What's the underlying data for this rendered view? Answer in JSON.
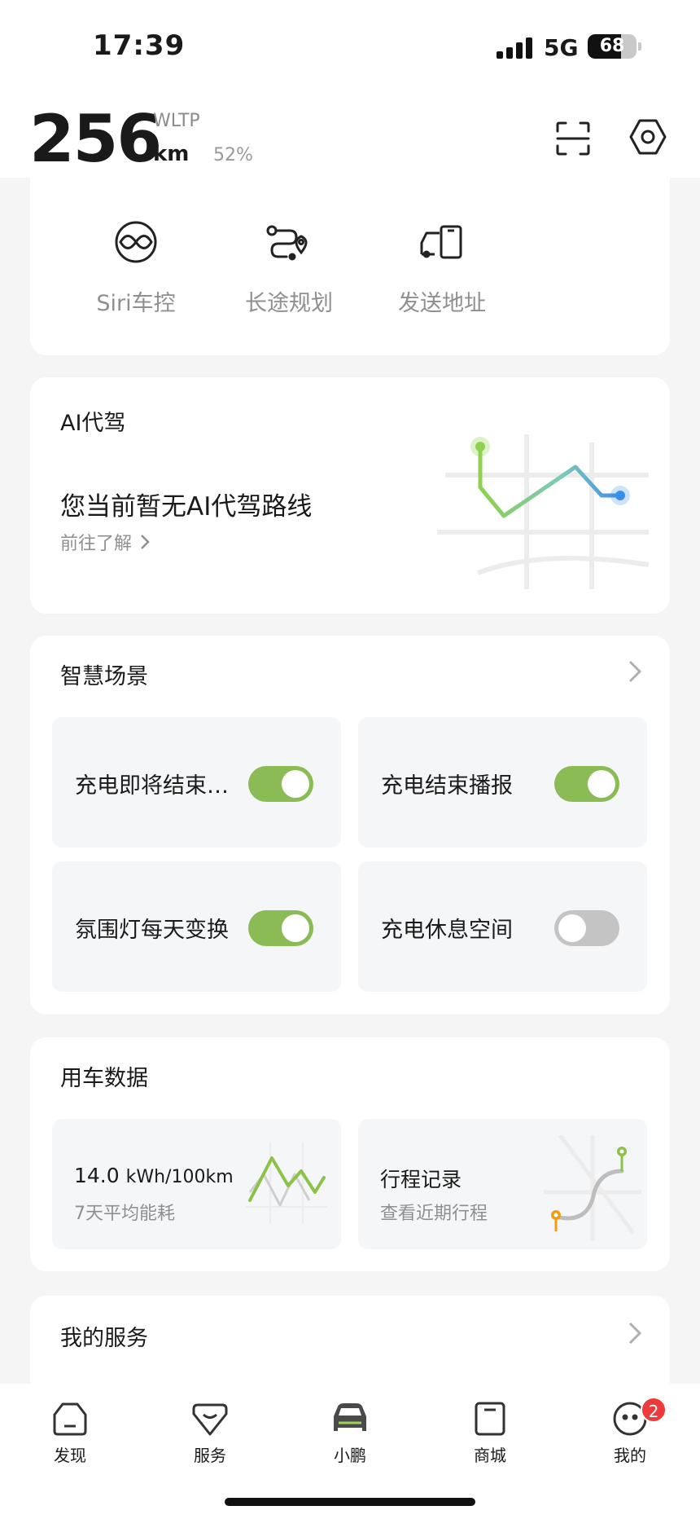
{
  "status_bar": {
    "time": "17:39",
    "network": "5G",
    "battery_level": "68",
    "battery_fraction": 0.68,
    "signal_bars": 4
  },
  "header": {
    "range_value": "256",
    "range_unit": "km",
    "range_standard": "WLTP",
    "battery_percent": "52%",
    "icons": [
      "scan-icon",
      "settings-icon"
    ]
  },
  "quick_actions": [
    {
      "label": "Siri车控",
      "icon": "siri-control-icon"
    },
    {
      "label": "长途规划",
      "icon": "route-planning-icon"
    },
    {
      "label": "发送地址",
      "icon": "send-address-icon"
    }
  ],
  "ai_drive": {
    "title": "AI代驾",
    "headline": "您当前暂无AI代驾路线",
    "link_label": "前往了解"
  },
  "scenes": {
    "title": "智慧场景",
    "items": [
      {
        "label": "充电即将结束提醒",
        "on": true
      },
      {
        "label": "充电结束播报",
        "on": true
      },
      {
        "label": "氛围灯每天变换",
        "on": true
      },
      {
        "label": "充电休息空间",
        "on": false
      }
    ]
  },
  "vehicle_data": {
    "title": "用车数据",
    "energy_value": "14.0",
    "energy_unit": "kWh/100km",
    "energy_caption": "7天平均能耗",
    "trip_title": "行程记录",
    "trip_caption": "查看近期行程"
  },
  "services": {
    "title": "我的服务"
  },
  "tab_bar": {
    "tabs": [
      {
        "label": "发现",
        "icon": "discover-icon"
      },
      {
        "label": "服务",
        "icon": "service-icon"
      },
      {
        "label": "小鹏",
        "icon": "car-icon",
        "active": true
      },
      {
        "label": "商城",
        "icon": "shop-icon"
      },
      {
        "label": "我的",
        "icon": "profile-icon",
        "badge": "2"
      }
    ]
  },
  "colors": {
    "toggle_on": "#8bbb55",
    "toggle_off": "#c4c4c4",
    "badge": "#ee3a3a",
    "route_start": "#8fd14f",
    "route_end": "#3b8ee6"
  }
}
